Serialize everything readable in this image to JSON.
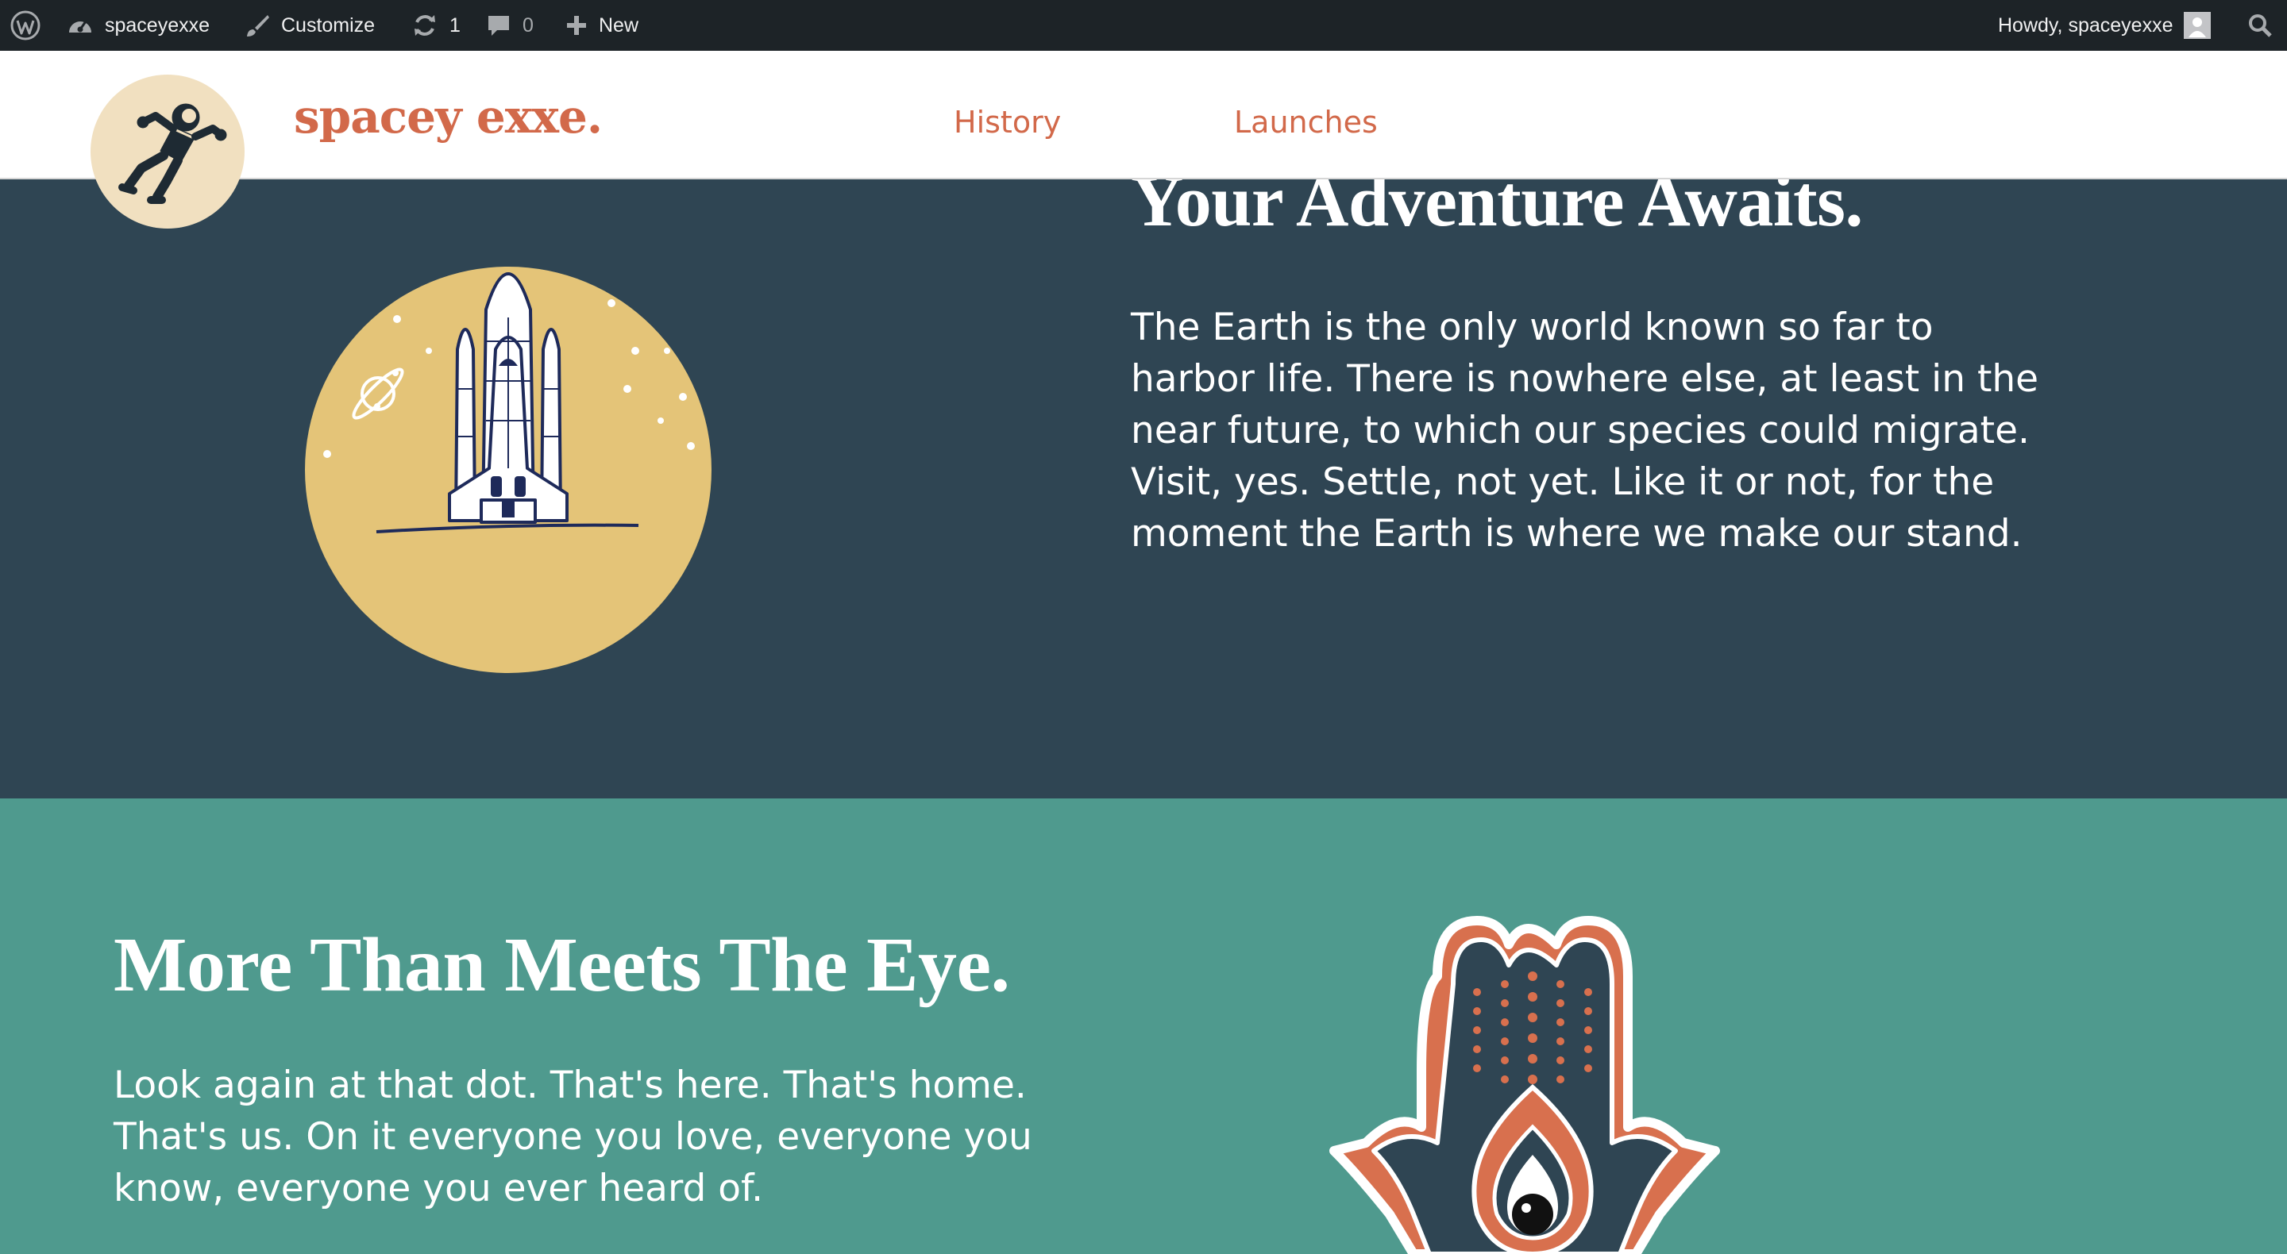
{
  "admin_bar": {
    "site_name": "spaceyexxe",
    "customize_label": "Customize",
    "updates_count": "1",
    "comments_count": "0",
    "new_label": "New",
    "howdy_label": "Howdy, spaceyexxe",
    "icons": [
      "wordpress-icon",
      "dashboard-icon",
      "brush-icon",
      "refresh-icon",
      "comment-icon",
      "plus-icon",
      "avatar",
      "search-icon"
    ]
  },
  "header": {
    "site_title": "spacey exxe.",
    "nav": [
      {
        "label": "History"
      },
      {
        "label": "Launches"
      }
    ]
  },
  "hero": {
    "title": "Your Adventure Awaits.",
    "text": "The Earth is the only world known so far to harbor life. There is nowhere else, at least in the near future, to which our species could migrate. Visit, yes. Settle, not yet. Like it or not, for the moment the Earth is where we make our stand."
  },
  "section2": {
    "title": "More Than Meets The Eye.",
    "text": "Look again at that dot. That's here. That's home. That's us. On it everyone you love, everyone you know, everyone you ever heard of."
  },
  "colors": {
    "admin_bar_bg": "#1d2327",
    "accent": "#d2694a",
    "hero_bg": "#2f4553",
    "section2_bg": "#4f9a8e",
    "sun_yellow": "#e4c478",
    "logo_bg": "#f1e0c0"
  }
}
